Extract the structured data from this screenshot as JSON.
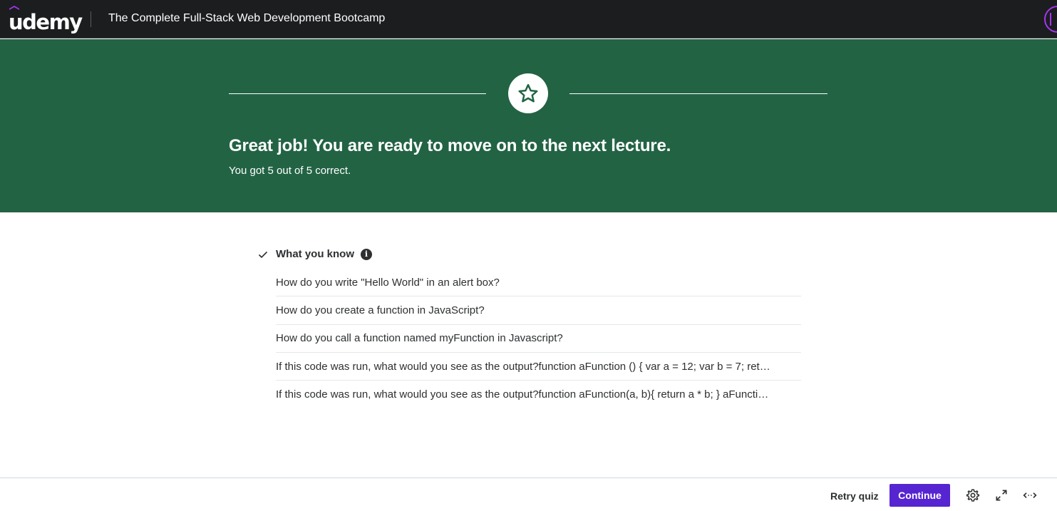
{
  "header": {
    "logo_text": "udemy",
    "course_title": "The Complete Full-Stack Web Development Bootcamp",
    "brand_color": "#a435f0"
  },
  "banner": {
    "icon": "star-icon",
    "heading": "Great job! You are ready to move on to the next lecture.",
    "subtext": "You got 5 out of 5 correct.",
    "background_color": "#226344"
  },
  "results": {
    "section_title": "What you know",
    "section_icon": "check-icon",
    "info_icon_glyph": "i",
    "questions": [
      "How do you write \"Hello World\" in an alert box?",
      "How do you create a function in JavaScript?",
      "How do you call a function named myFunction in Javascript?",
      "If this code was run, what would you see as the output?function aFunction () { var a = 12; var b = 7; ret…",
      "If this code was run, what would you see as the output?function aFunction(a, b){ return a * b; } aFuncti…"
    ]
  },
  "footer": {
    "retry_label": "Retry quiz",
    "continue_label": "Continue",
    "continue_color": "#5624d0",
    "icons": [
      "gear-icon",
      "expand-icon",
      "wide-mode-icon"
    ]
  }
}
